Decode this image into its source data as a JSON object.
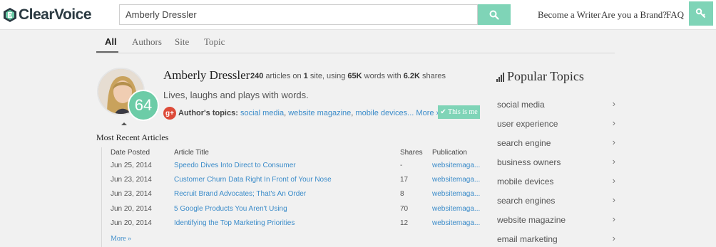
{
  "header": {
    "brand": "ClearVoice",
    "search_value": "Amberly Dressler",
    "nav": [
      "Become a Writer",
      "Are you a Brand?",
      "FAQ"
    ]
  },
  "tabs": [
    "All",
    "Authors",
    "Site",
    "Topic"
  ],
  "author": {
    "name": "Amberly Dressler",
    "articles_count": "240",
    "sites_count": "1",
    "words": "65K",
    "shares": "6.2K",
    "stats_t1": "articles on",
    "stats_t2": "site, using",
    "stats_t3": "words with",
    "stats_t4": "shares",
    "tagline": "Lives, laughs and plays with words.",
    "score": "64",
    "topics_label": "Author's topics:",
    "topics": [
      "social media",
      "website magazine",
      "mobile devices..."
    ],
    "topics_more": "More »",
    "this_is_me": "✔ This is me"
  },
  "articles": {
    "section_title": "Most Recent Articles",
    "columns": [
      "Date Posted",
      "Article Title",
      "Shares",
      "Publication"
    ],
    "rows": [
      {
        "date": "Jun 25, 2014",
        "title": "Speedo Dives Into Direct to Consumer",
        "shares": "-",
        "publication": "websitemaga..."
      },
      {
        "date": "Jun 23, 2014",
        "title": "Customer Churn Data Right In Front of Your Nose",
        "shares": "17",
        "publication": "websitemaga..."
      },
      {
        "date": "Jun 23, 2014",
        "title": "Recruit Brand Advocates; That's An Order",
        "shares": "8",
        "publication": "websitemaga..."
      },
      {
        "date": "Jun 20, 2014",
        "title": "5 Google Products You Aren't Using",
        "shares": "70",
        "publication": "websitemaga..."
      },
      {
        "date": "Jun 20, 2014",
        "title": "Identifying the Top Marketing Priorities",
        "shares": "12",
        "publication": "websitemaga..."
      }
    ],
    "more": "More »"
  },
  "popular_topics": {
    "title": "Popular Topics",
    "items": [
      "social media",
      "user experience",
      "search engine",
      "business owners",
      "mobile devices",
      "search engines",
      "website magazine",
      "email marketing"
    ]
  },
  "colors": {
    "accent": "#7fd4b7",
    "score": "#6ccca7",
    "link": "#3a8bc9",
    "gplus": "#dd4b39"
  },
  "icons": {
    "search": "search-icon",
    "key": "key-icon",
    "gplus": "google-plus-icon",
    "chevron": "chevron-right-icon"
  }
}
